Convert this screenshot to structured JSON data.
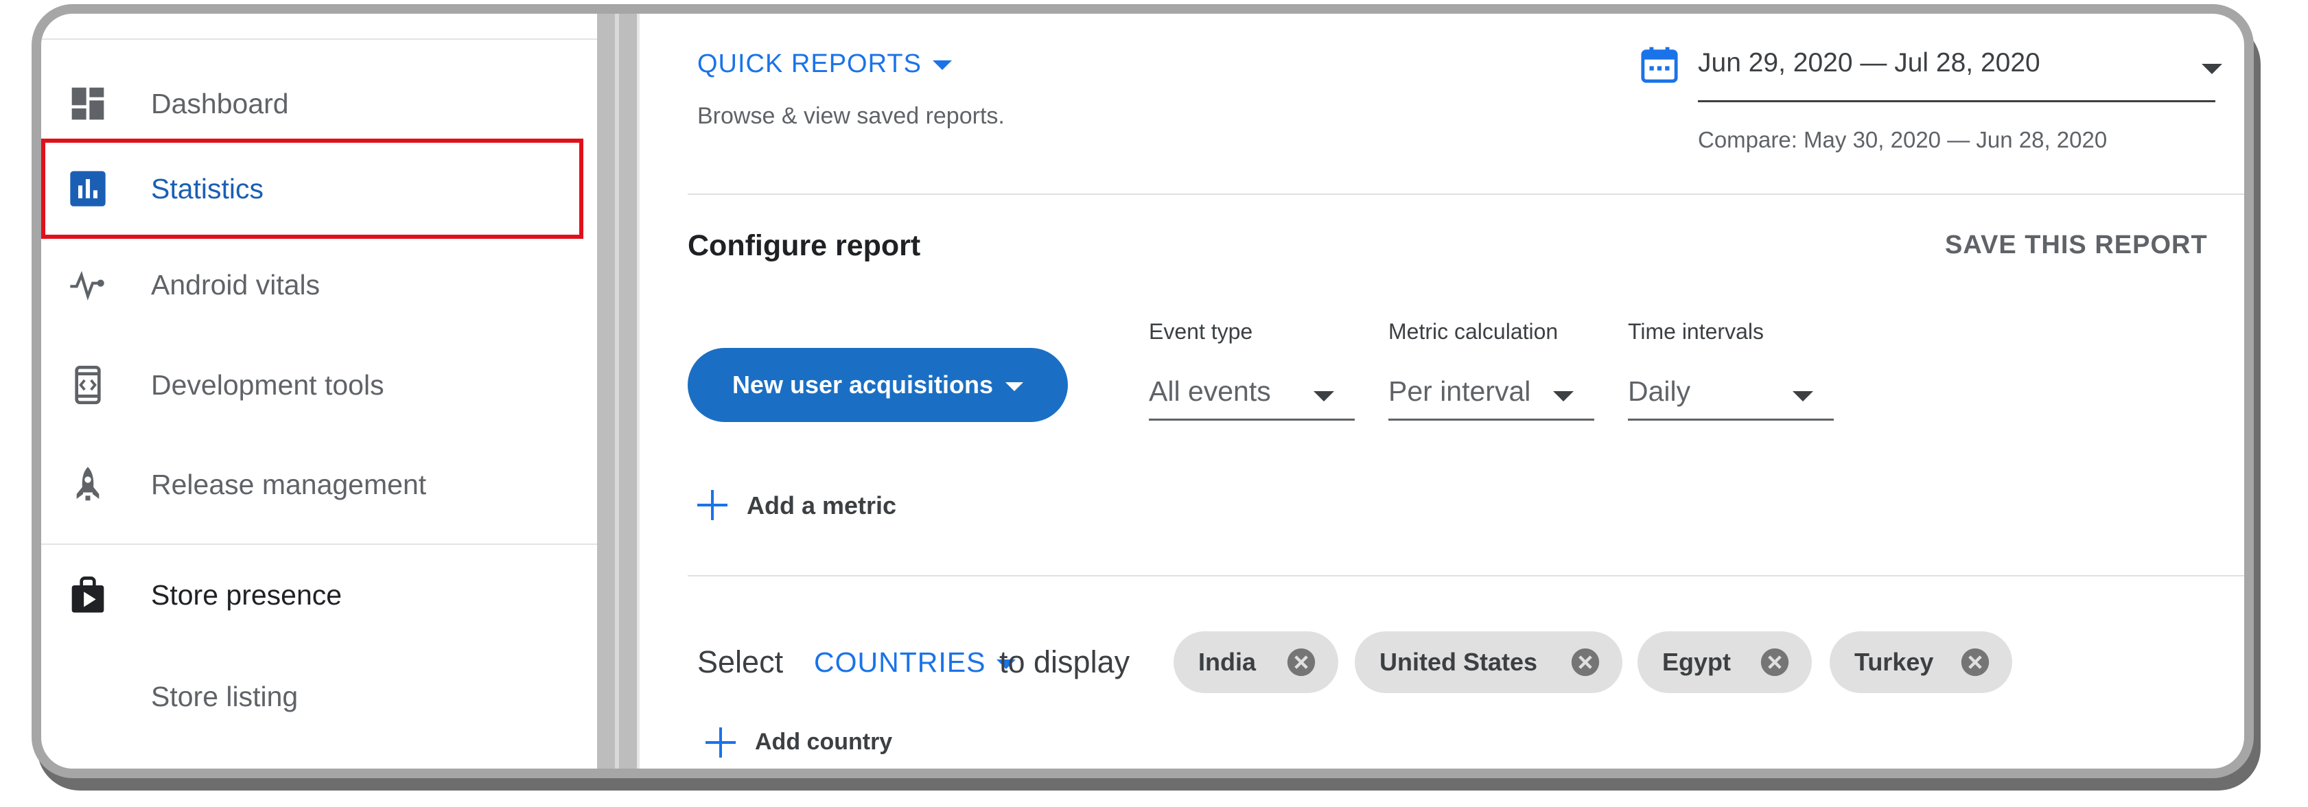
{
  "sidebar": {
    "items": [
      {
        "label": "Dashboard",
        "icon": "dashboard-icon"
      },
      {
        "label": "Statistics",
        "icon": "bar-chart-icon"
      },
      {
        "label": "Android vitals",
        "icon": "pulse-icon"
      },
      {
        "label": "Development tools",
        "icon": "code-device-icon"
      },
      {
        "label": "Release management",
        "icon": "rocket-icon"
      },
      {
        "label": "Store presence",
        "icon": "play-bag-icon"
      },
      {
        "label": "Store listing"
      }
    ],
    "active_item": "Statistics"
  },
  "header": {
    "quick_reports": "QUICK REPORTS",
    "quick_reports_sub": "Browse & view saved reports.",
    "date_range": "Jun 29, 2020 — Jul 28, 2020",
    "compare": "Compare: May 30, 2020 — Jun 28, 2020"
  },
  "configure": {
    "title": "Configure report",
    "save": "SAVE THIS REPORT",
    "metric_button": "New user acquisitions",
    "dropdowns": [
      {
        "label": "Event type",
        "value": "All events"
      },
      {
        "label": "Metric calculation",
        "value": "Per interval"
      },
      {
        "label": "Time intervals",
        "value": "Daily"
      }
    ],
    "add_metric": "Add a metric"
  },
  "countries": {
    "select_prefix": "Select",
    "dimension": "COUNTRIES",
    "select_suffix": "to display",
    "chips": [
      "India",
      "United States",
      "Egypt",
      "Turkey"
    ],
    "add_country": "Add country"
  },
  "colors": {
    "accent": "#1a73e8",
    "button": "#1a6fc4",
    "highlight": "#e0111b"
  }
}
